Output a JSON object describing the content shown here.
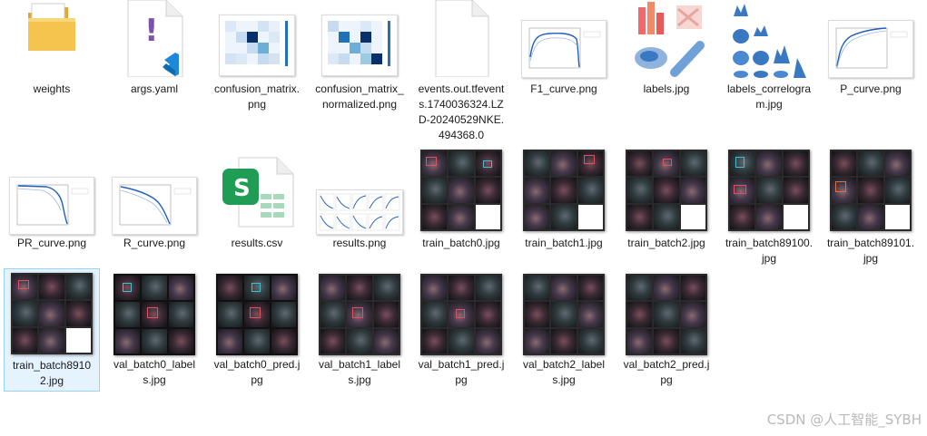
{
  "files": [
    {
      "name": "weights",
      "type": "folder"
    },
    {
      "name": "args.yaml",
      "type": "yaml",
      "icon": "vscode-icon"
    },
    {
      "name": "confusion_matrix.png",
      "type": "png"
    },
    {
      "name": "confusion_matrix_normalized.png",
      "type": "png"
    },
    {
      "name": "events.out.tfevents.1740036324.LZD-20240529NKE.494368.0",
      "type": "file"
    },
    {
      "name": "F1_curve.png",
      "type": "png"
    },
    {
      "name": "labels.jpg",
      "type": "jpg"
    },
    {
      "name": "labels_correlogram.jpg",
      "type": "jpg"
    },
    {
      "name": "P_curve.png",
      "type": "png"
    },
    {
      "name": "PR_curve.png",
      "type": "png"
    },
    {
      "name": "R_curve.png",
      "type": "png"
    },
    {
      "name": "results.csv",
      "type": "csv",
      "icon_letter": "S"
    },
    {
      "name": "results.png",
      "type": "png"
    },
    {
      "name": "train_batch0.jpg",
      "type": "jpg"
    },
    {
      "name": "train_batch1.jpg",
      "type": "jpg"
    },
    {
      "name": "train_batch2.jpg",
      "type": "jpg"
    },
    {
      "name": "train_batch89100.jpg",
      "type": "jpg"
    },
    {
      "name": "train_batch89101.jpg",
      "type": "jpg"
    },
    {
      "name": "train_batch89102.jpg",
      "type": "jpg",
      "selected": true
    },
    {
      "name": "val_batch0_labels.jpg",
      "type": "jpg"
    },
    {
      "name": "val_batch0_pred.jpg",
      "type": "jpg"
    },
    {
      "name": "val_batch1_labels.jpg",
      "type": "jpg"
    },
    {
      "name": "val_batch1_pred.jpg",
      "type": "jpg"
    },
    {
      "name": "val_batch2_labels.jpg",
      "type": "jpg"
    },
    {
      "name": "val_batch2_pred.jpg",
      "type": "jpg"
    }
  ],
  "watermark": "CSDN @人工智能_SYBH",
  "colors": {
    "selection_border": "#99d1ff",
    "selection_fill": "#e5f3ff",
    "folder": "#f4c44e",
    "excel_green": "#1f9d55",
    "vscode_blue": "#1d8ad9",
    "yaml_purple": "#7b52ab"
  }
}
